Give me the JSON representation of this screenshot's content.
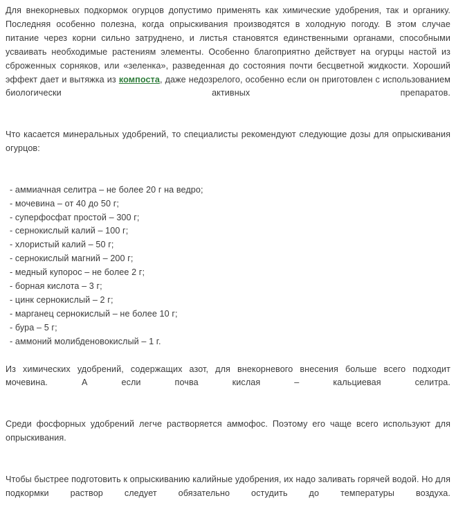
{
  "document": {
    "text_color": "#3a3a3a",
    "link_color": "#2f7d3b",
    "background_color": "#ffffff",
    "paragraphs": {
      "intro_part1": "Для внекорневых подкормок огурцов допустимо применять как химические удобрения, так и органику. Последняя особенно полезна, когда опрыскивания производятся в холодную погоду. В этом случае питание через корни сильно затруднено, и листья становятся единственными органами, способными усваивать необходимые растениям элементы. Особенно благоприятно действует на огурцы настой из сброженных сорняков, или «зеленка», разведенная до состояния почти бесцветной жидкости. Хороший эффект дает и вытяжка из ",
      "intro_link": "компоста",
      "intro_part2": ", даже недозрелого, особенно если он приготовлен с использованием биологически активных препаратов.",
      "minerals_intro": "Что касается минеральных удобрений, то специалисты рекомендуют следующие дозы для опрыскивания огурцов:",
      "nitrogen": "Из химических удобрений, содержащих азот, для внекорневого внесения больше всего подходит мочевина. А если почва кислая – кальциевая селитра.",
      "phosphorus": "Среди фосфорных удобрений легче растворяется аммофос. Поэтому его чаще всего используют для опрыскивания.",
      "potassium": "Чтобы быстрее подготовить к опрыскиванию калийные удобрения, их надо заливать горячей водой. Но для подкормки раствор следует обязательно остудить до температуры воздуха."
    },
    "dose_list": [
      "- аммиачная селитра – не более 20 г на ведро;",
      "- мочевина – от 40 до 50 г;",
      "- суперфосфат простой – 300 г;",
      "- сернокислый калий – 100 г;",
      "- хлористый калий – 50 г;",
      "- сернокислый магний – 200 г;",
      "- медный купорос – не более 2 г;",
      "- борная кислота – 3 г;",
      "- цинк сернокислый – 2 г;",
      "- марганец сернокислый – не более 10 г;",
      "- бура – 5 г;",
      "- аммоний молибденовокислый – 1 г."
    ]
  }
}
